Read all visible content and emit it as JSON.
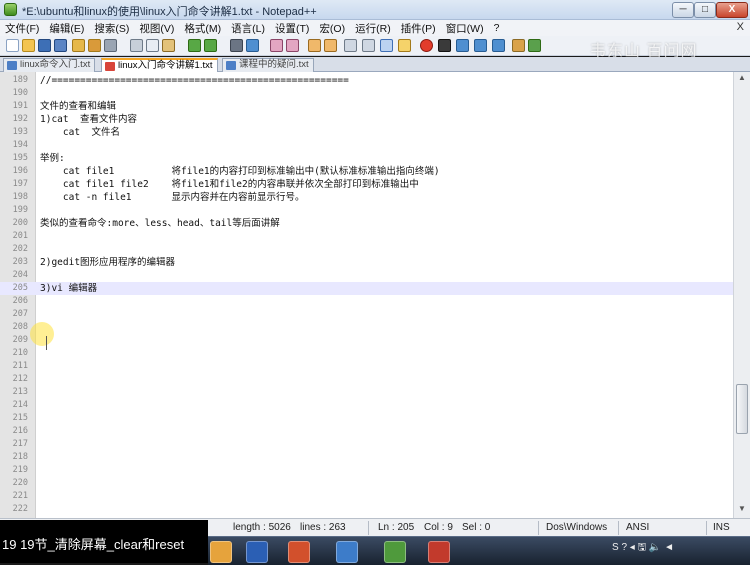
{
  "window": {
    "title": "*E:\\ubuntu和linux的使用\\linux入门命令讲解1.txt - Notepad++",
    "minimize": "─",
    "maximize": "□",
    "close": "X"
  },
  "menu": {
    "items": [
      "文件(F)",
      "编辑(E)",
      "搜索(S)",
      "视图(V)",
      "格式(M)",
      "语言(L)",
      "设置(T)",
      "宏(O)",
      "运行(R)",
      "插件(P)",
      "窗口(W)",
      "?"
    ],
    "close": "X"
  },
  "watermark": "韦东山 百问网",
  "tabs": [
    {
      "label": "linux命令入门.txt"
    },
    {
      "label": "linux入门命令讲解1.txt"
    },
    {
      "label": "课程中的疑问.txt"
    }
  ],
  "editor": {
    "current_line": 205,
    "lines": [
      {
        "n": "189",
        "text": "//===================================================="
      },
      {
        "n": "190",
        "text": ""
      },
      {
        "n": "191",
        "text": "文件的查看和编辑"
      },
      {
        "n": "192",
        "text": "1)cat  查看文件内容"
      },
      {
        "n": "193",
        "text": "    cat  文件名"
      },
      {
        "n": "194",
        "text": ""
      },
      {
        "n": "195",
        "text": "举例:"
      },
      {
        "n": "196",
        "text": "    cat file1          将file1的内容打印到标准输出中(默认标准标准输出指向终端)"
      },
      {
        "n": "197",
        "text": "    cat file1 file2    将file1和file2的内容串联并依次全部打印到标准输出中"
      },
      {
        "n": "198",
        "text": "    cat -n file1       显示内容并在内容前显示行号。"
      },
      {
        "n": "199",
        "text": ""
      },
      {
        "n": "200",
        "text": "类似的查看命令:more、less、head、tail等后面讲解"
      },
      {
        "n": "201",
        "text": ""
      },
      {
        "n": "202",
        "text": ""
      },
      {
        "n": "203",
        "text": "2)gedit图形应用程序的编辑器"
      },
      {
        "n": "204",
        "text": ""
      },
      {
        "n": "205",
        "text": "3)vi 编辑器"
      },
      {
        "n": "206",
        "text": ""
      },
      {
        "n": "207",
        "text": ""
      },
      {
        "n": "208",
        "text": ""
      },
      {
        "n": "209",
        "text": ""
      },
      {
        "n": "210",
        "text": ""
      },
      {
        "n": "211",
        "text": ""
      },
      {
        "n": "212",
        "text": ""
      },
      {
        "n": "213",
        "text": ""
      },
      {
        "n": "214",
        "text": ""
      },
      {
        "n": "215",
        "text": ""
      },
      {
        "n": "216",
        "text": ""
      },
      {
        "n": "217",
        "text": ""
      },
      {
        "n": "218",
        "text": ""
      },
      {
        "n": "219",
        "text": ""
      },
      {
        "n": "220",
        "text": ""
      },
      {
        "n": "221",
        "text": ""
      },
      {
        "n": "222",
        "text": ""
      }
    ]
  },
  "status": {
    "length": "length : 5026",
    "lines": "lines : 263",
    "ln": "Ln : 205",
    "col": "Col : 9",
    "sel": "Sel : 0",
    "eol": "Dos\\Windows",
    "encoding": "ANSI",
    "mode": "INS"
  },
  "caption": "19 19节_清除屏幕_clear和reset",
  "taskbar": {
    "tray": "S ? ◂ 🖫 🔈 ◄"
  },
  "colors": {
    "current_line_bg": "#e8e8ff",
    "tab_accent": "#f5a623",
    "gutter_bg": "#e4e4e4"
  }
}
